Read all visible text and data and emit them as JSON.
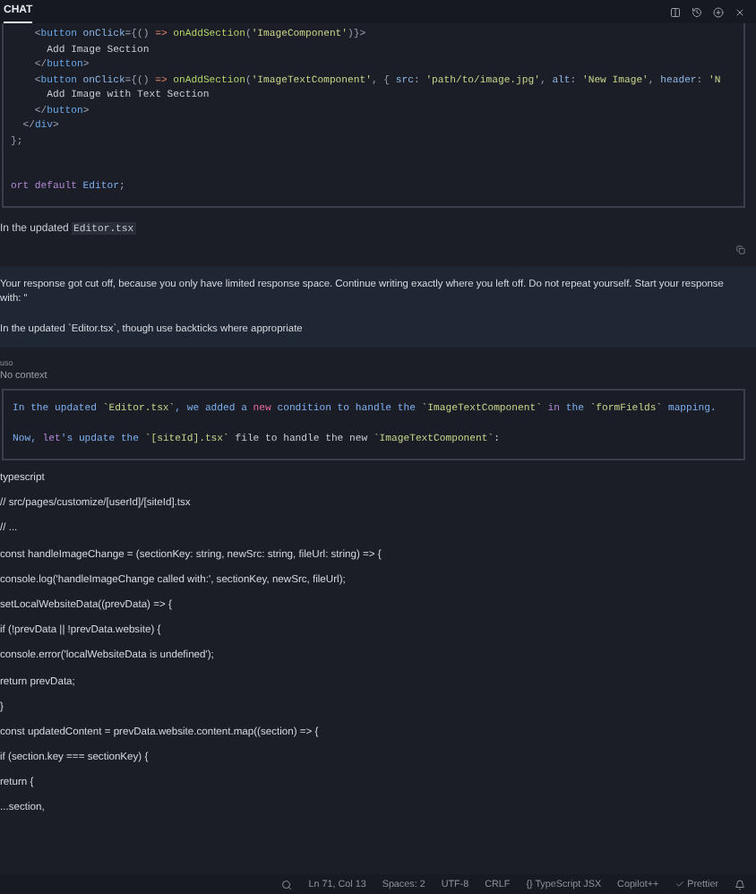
{
  "panel": {
    "tab": "CHAT"
  },
  "code_block": {
    "lines": [
      [
        {
          "kind": "punct",
          "text": "    <"
        },
        {
          "kind": "tag",
          "text": "button "
        },
        {
          "kind": "attr",
          "text": "onClick"
        },
        {
          "kind": "punct",
          "text": "={() "
        },
        {
          "kind": "op",
          "text": "=>"
        },
        {
          "kind": "fn",
          "text": " onAddSection"
        },
        {
          "kind": "punct",
          "text": "("
        },
        {
          "kind": "str",
          "text": "'ImageComponent'"
        },
        {
          "kind": "punct",
          "text": ")}>"
        }
      ],
      [
        {
          "kind": "text",
          "text": "      Add Image Section"
        }
      ],
      [
        {
          "kind": "punct",
          "text": "    </"
        },
        {
          "kind": "tag",
          "text": "button"
        },
        {
          "kind": "punct",
          "text": ">"
        }
      ],
      [
        {
          "kind": "punct",
          "text": "    <"
        },
        {
          "kind": "tag",
          "text": "button "
        },
        {
          "kind": "attr",
          "text": "onClick"
        },
        {
          "kind": "punct",
          "text": "={() "
        },
        {
          "kind": "op",
          "text": "=>"
        },
        {
          "kind": "fn",
          "text": " onAddSection"
        },
        {
          "kind": "punct",
          "text": "("
        },
        {
          "kind": "str",
          "text": "'ImageTextComponent'"
        },
        {
          "kind": "punct",
          "text": ", { "
        },
        {
          "kind": "attr",
          "text": "src"
        },
        {
          "kind": "punct",
          "text": ": "
        },
        {
          "kind": "str",
          "text": "'path/to/image.jpg'"
        },
        {
          "kind": "punct",
          "text": ", "
        },
        {
          "kind": "attr",
          "text": "alt"
        },
        {
          "kind": "punct",
          "text": ": "
        },
        {
          "kind": "str",
          "text": "'New Image'"
        },
        {
          "kind": "punct",
          "text": ", "
        },
        {
          "kind": "attr",
          "text": "header"
        },
        {
          "kind": "punct",
          "text": ": "
        },
        {
          "kind": "str",
          "text": "'N"
        }
      ],
      [
        {
          "kind": "text",
          "text": "      Add Image with Text Section"
        }
      ],
      [
        {
          "kind": "punct",
          "text": "    </"
        },
        {
          "kind": "tag",
          "text": "button"
        },
        {
          "kind": "punct",
          "text": ">"
        }
      ],
      [
        {
          "kind": "punct",
          "text": "  </"
        },
        {
          "kind": "tag",
          "text": "div"
        },
        {
          "kind": "punct",
          "text": ">"
        }
      ],
      [
        {
          "kind": "punct",
          "text": "};"
        }
      ],
      [
        {
          "kind": "kw",
          "text": "ort default "
        },
        {
          "kind": "ident",
          "text": "Editor"
        },
        {
          "kind": "punct",
          "text": ";"
        }
      ]
    ]
  },
  "answer_tail": {
    "text": "In the updated",
    "code": "Editor.tsx"
  },
  "prompt": {
    "paragraphs": [
      "Your response got cut off, because you only have limited response space. Continue writing exactly where you left off. Do not repeat yourself. Start your response with: \"",
      "In the updated `Editor.tsx`, though use backticks where appropriate"
    ]
  },
  "context": {
    "model": "uso",
    "label": "No context"
  },
  "response_block": {
    "lines": [
      [
        {
          "kind": "ident",
          "text": "In the updated "
        },
        {
          "kind": "str",
          "text": "`Editor.tsx`"
        },
        {
          "kind": "ident",
          "text": ", we added a "
        },
        {
          "kind": "hl",
          "text": "new"
        },
        {
          "kind": "ident",
          "text": " condition to handle the "
        },
        {
          "kind": "str",
          "text": "`ImageTextComponent`"
        },
        {
          "kind": "kw",
          "text": " in"
        },
        {
          "kind": "ident",
          "text": " the "
        },
        {
          "kind": "str",
          "text": "`formFields`"
        },
        {
          "kind": "ident",
          "text": " mapping."
        }
      ],
      [
        {
          "kind": "ident",
          "text": "Now, "
        },
        {
          "kind": "kw",
          "text": "let"
        },
        {
          "kind": "ident",
          "text": "'s update the "
        },
        {
          "kind": "str",
          "text": "`[siteId].tsx`"
        },
        {
          "kind": "text",
          "text": " file to handle the new "
        },
        {
          "kind": "str",
          "text": "`ImageTextComponent`"
        },
        {
          "kind": "text",
          "text": ":"
        }
      ]
    ]
  },
  "plain_lines": [
    "typescript",
    "// src/pages/customize/[userId]/[siteId].tsx",
    "// ...",
    "const handleImageChange = (sectionKey: string, newSrc: string, fileUrl: string) => {",
    "console.log('handleImageChange called with:', sectionKey, newSrc, fileUrl);",
    "setLocalWebsiteData((prevData) => {",
    "if (!prevData || !prevData.website) {",
    "console.error('localWebsiteData is undefined');",
    "return prevData;",
    "}",
    "const updatedContent = prevData.website.content.map((section) => {",
    "if (section.key === sectionKey) {",
    "return {",
    "...section,"
  ],
  "status_bar": [
    {
      "kind": "search"
    },
    {
      "kind": "text",
      "text": "Ln 71, Col 13"
    },
    {
      "kind": "text",
      "text": "Spaces: 2"
    },
    {
      "kind": "text",
      "text": "UTF-8"
    },
    {
      "kind": "text",
      "text": "CRLF"
    },
    {
      "kind": "braces",
      "text": "{} TypeScript JSX"
    },
    {
      "kind": "text",
      "text": "Copilot++"
    },
    {
      "kind": "check",
      "text": "Prettier"
    },
    {
      "kind": "bell"
    }
  ]
}
